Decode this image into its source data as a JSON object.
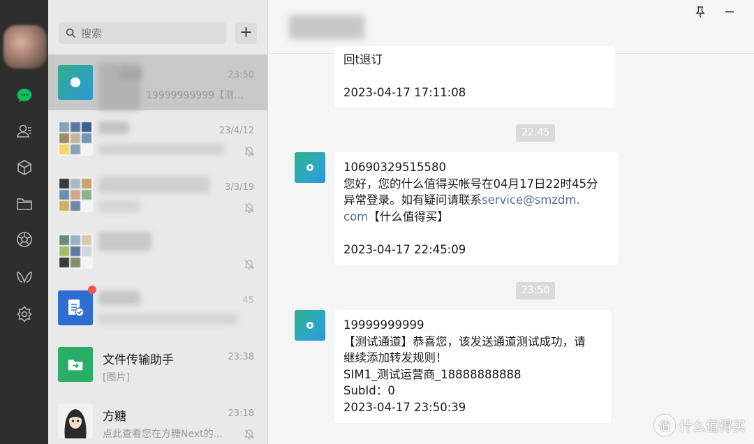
{
  "sidebar": {
    "nav": [
      "chat-icon",
      "contacts-icon",
      "favorites-icon",
      "files-icon",
      "moments-icon",
      "mini-programs-icon",
      "settings-icon"
    ],
    "active_color": "#07c160"
  },
  "search": {
    "placeholder": "搜索",
    "add_label": "+"
  },
  "chats": [
    {
      "name": "",
      "time": "23:50",
      "preview": "19999999999【测试...",
      "muted": false
    },
    {
      "name": "",
      "time": "23/4/12",
      "preview": "",
      "muted": true
    },
    {
      "name": "",
      "time": "3/3/19",
      "preview": "",
      "muted": true
    },
    {
      "name": "",
      "time": "",
      "preview": "",
      "muted": true
    },
    {
      "name": "",
      "time": "45",
      "preview": "",
      "muted": false
    },
    {
      "name": "文件传输助手",
      "time": "23:38",
      "preview": "[图片]",
      "muted": false
    },
    {
      "name": "方糖",
      "time": "23:18",
      "preview": "点此查看您在方糖Next的...",
      "muted": true
    }
  ],
  "conversation": {
    "messages": [
      {
        "lines": "回t退订\n\n2023-04-17 17:11:08"
      },
      {
        "time_chip": "22:45"
      },
      {
        "line1": "10690329515580",
        "line2": "您好，您的什么值得买帐号在04月17日22时45分",
        "line3a": "异常登录。如有疑问请联系",
        "link_a": "service@smzdm.",
        "link_b": "com",
        "line4b": "【什么值得买】",
        "footer": "2023-04-17 22:45:09"
      },
      {
        "time_chip": "23:50"
      },
      {
        "lines": "19999999999\n【测试通道】恭喜您，该发送通道测试成功，请\n继续添加转发规则！\nSIM1_测试运营商_18888888888\nSubId：0\n2023-04-17 23:50:39"
      }
    ]
  },
  "watermark": {
    "text": "什么值得买",
    "icon": "值"
  },
  "colors": {
    "rail": "#2e2e2e",
    "list_bg": "#e9e9e9",
    "active_item": "#c8c8c8",
    "bubble": "#ffffff",
    "link": "#576b95"
  }
}
